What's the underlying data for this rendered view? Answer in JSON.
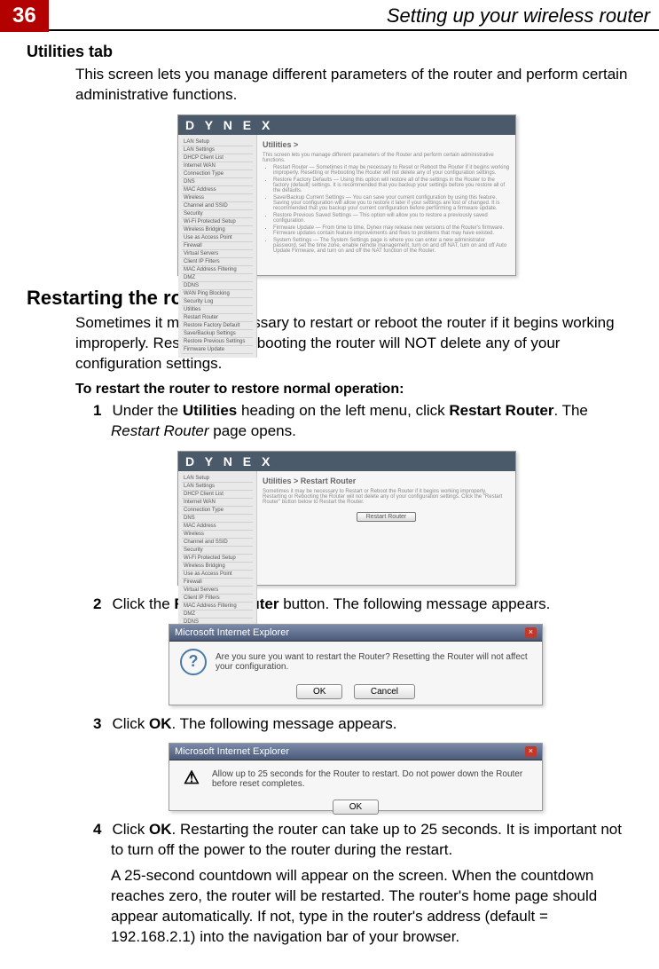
{
  "header": {
    "page_number": "36",
    "title": "Setting up your wireless router"
  },
  "section1": {
    "title": "Utilities tab",
    "body": "This screen lets you manage different parameters of the router and perform certain administrative functions."
  },
  "shot1": {
    "brand": "D Y N E X",
    "main_title": "Utilities >",
    "intro": "This screen lets you manage different parameters of the Router and perform certain administrative functions.",
    "bullets": [
      "Restart Router — Sometimes it may be necessary to Reset or Reboot the Router if it begins working improperly. Resetting or Rebooting the Router will not delete any of your configuration settings.",
      "Restore Factory Defaults — Using this option will restore all of the settings in the Router to the factory (default) settings. It is recommended that you backup your settings before you restore all of the defaults.",
      "Save/Backup Current Settings — You can save your current configuration by using this feature. Saving your configuration will allow you to restore it later if your settings are lost or changed. It is recommended that you backup your current configuration before performing a firmware update.",
      "Restore Previous Saved Settings — This option will allow you to restore a previously saved configuration.",
      "Firmware Update — From time to time, Dynex may release new versions of the Router's firmware. Firmware updates contain feature improvements and fixes to problems that may have existed.",
      "System Settings — The System Settings page is where you can enter a new administrator password, set the time zone, enable remote management, turn on and off NAT, turn on and off Auto Update Firmware, and turn on and off the NAT function of the Router."
    ],
    "sidebar": [
      "LAN Setup",
      "LAN Settings",
      "DHCP Client List",
      "Internet WAN",
      "Connection Type",
      "DNS",
      "MAC Address",
      "Wireless",
      "Channel and SSID",
      "Security",
      "Wi-Fi Protected Setup",
      "Wireless Bridging",
      "Use as Access Point",
      "Firewall",
      "Virtual Servers",
      "Client IP Filters",
      "MAC Address Filtering",
      "DMZ",
      "DDNS",
      "WAN Ping Blocking",
      "Security Log",
      "Utilities",
      "Restart Router",
      "Restore Factory Default",
      "Save/Backup Settings",
      "Restore Previous Settings",
      "Firmware Update"
    ]
  },
  "section2": {
    "title": "Restarting the router",
    "body": "Sometimes it may be necessary to restart or reboot the router if it begins working improperly. Restarting or rebooting the router will NOT delete any of your configuration settings.",
    "bold_line": "To restart the router to restore normal operation:"
  },
  "steps": {
    "s1_pre": "Under the ",
    "s1_bold1": "Utilities",
    "s1_mid": " heading on the left menu, click ",
    "s1_bold2": "Restart Router",
    "s1_mid2": ". The ",
    "s1_italic": "Restart Router",
    "s1_post": " page opens.",
    "s2_pre": "Click the ",
    "s2_bold": "Restart Router",
    "s2_post": " button. The following message appears.",
    "s3_pre": "Click ",
    "s3_bold": "OK",
    "s3_post": ". The following message appears.",
    "s4_pre": "Click ",
    "s4_bold": "OK",
    "s4_post": ". Restarting the router can take up to 25 seconds. It is important not to turn off the power to the router during the restart.",
    "s4_para2": "A 25-second countdown will appear on the screen. When the countdown reaches zero, the router will be restarted. The router's home page should appear automatically. If not, type in the router's address (default = 192.168.2.1) into the navigation bar of your browser."
  },
  "shot2": {
    "brand": "D Y N E X",
    "main_title": "Utilities > Restart Router",
    "body": "Sometimes it may be necessary to Restart or Reboot the Router if it begins working improperly. Restarting or Rebooting the Router will not delete any of your configuration settings. Click the \"Restart Router\" button below to Restart the Router.",
    "button": "Restart Router"
  },
  "dialog1": {
    "title": "Microsoft Internet Explorer",
    "text": "Are you sure you want to restart the Router? Resetting the Router will not affect your configuration.",
    "ok": "OK",
    "cancel": "Cancel",
    "icon": "?"
  },
  "dialog2": {
    "title": "Microsoft Internet Explorer",
    "text": "Allow up to 25 seconds for the Router to restart. Do not power down the Router before reset completes.",
    "ok": "OK",
    "icon": "⚠"
  }
}
